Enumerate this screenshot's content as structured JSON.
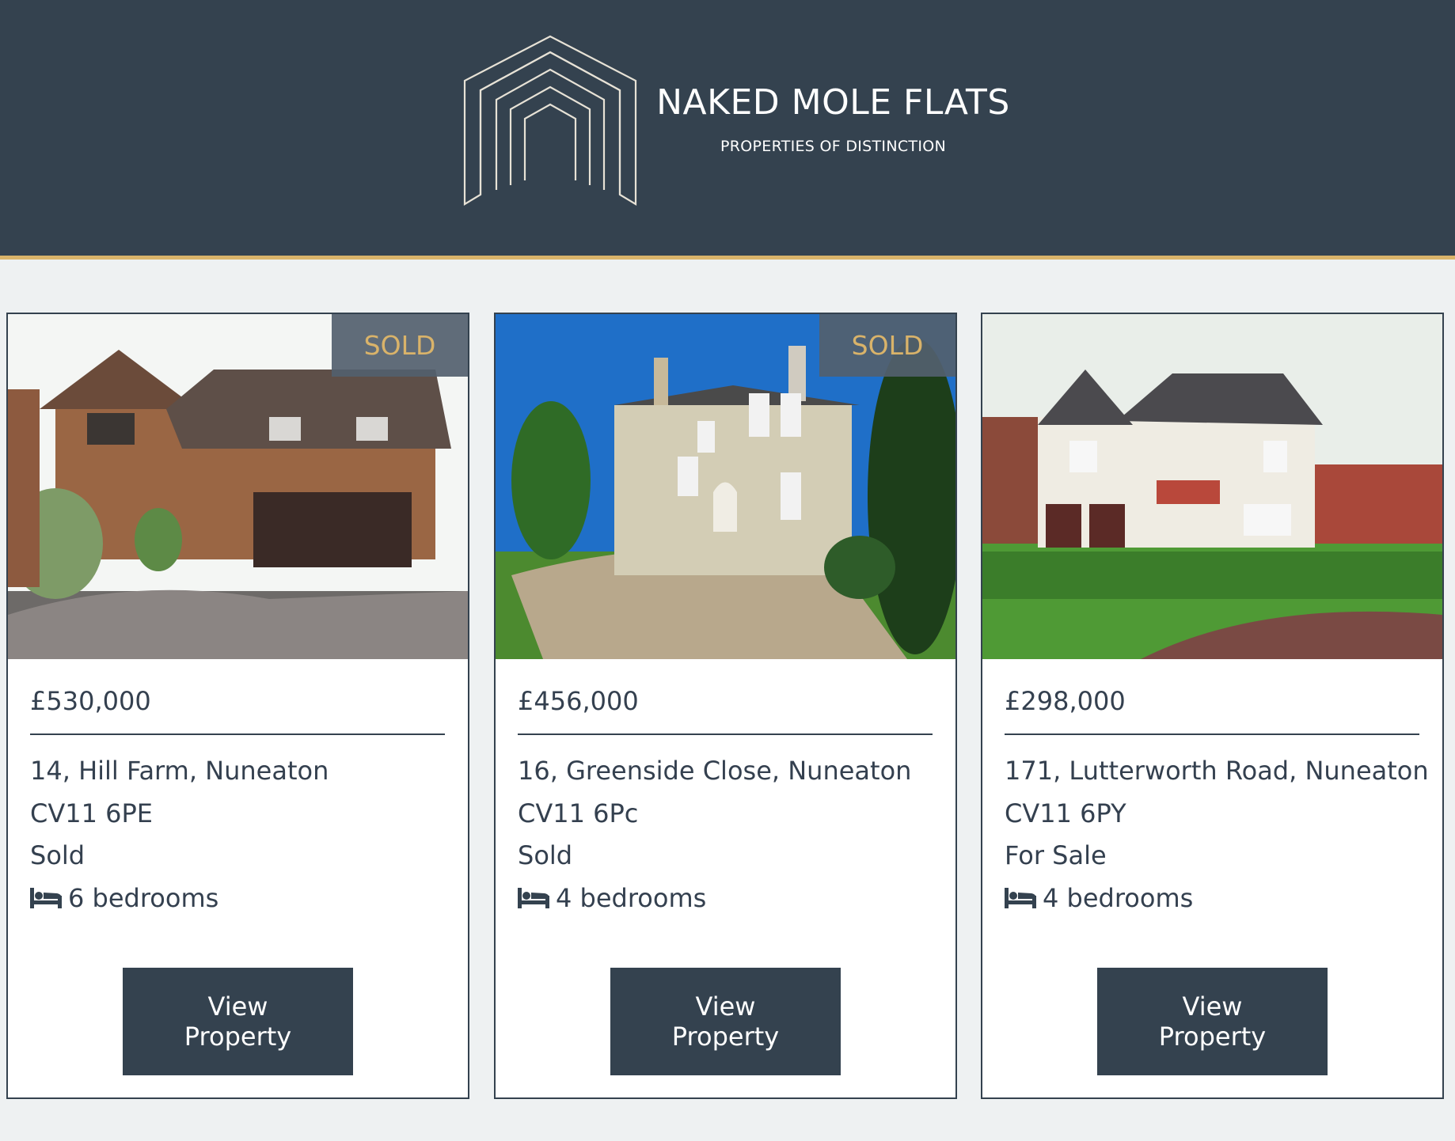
{
  "brand": {
    "title": "NAKED MOLE FLATS",
    "subtitle": "PROPERTIES OF DISTINCTION"
  },
  "colors": {
    "header_bg": "#34424f",
    "accent_gold": "#d9b36a",
    "page_bg": "#eef1f2",
    "text": "#34404f"
  },
  "properties": [
    {
      "badge": "SOLD",
      "price": "£530,000",
      "address": "14, Hill Farm, Nuneaton",
      "postcode": "CV11 6PE",
      "status": "Sold",
      "bedrooms": "6 bedrooms",
      "button": "View Property",
      "icon": "bed-icon"
    },
    {
      "badge": "SOLD",
      "price": "£456,000",
      "address": "16, Greenside Close, Nuneaton",
      "postcode": "CV11 6Pc",
      "status": "Sold",
      "bedrooms": "4 bedrooms",
      "button": "View Property",
      "icon": "bed-icon"
    },
    {
      "price": "£298,000",
      "address": "171, Lutterworth Road, Nuneaton",
      "postcode": "CV11 6PY",
      "status": "For Sale",
      "bedrooms": "4 bedrooms",
      "button": "View Property",
      "icon": "bed-icon"
    }
  ]
}
